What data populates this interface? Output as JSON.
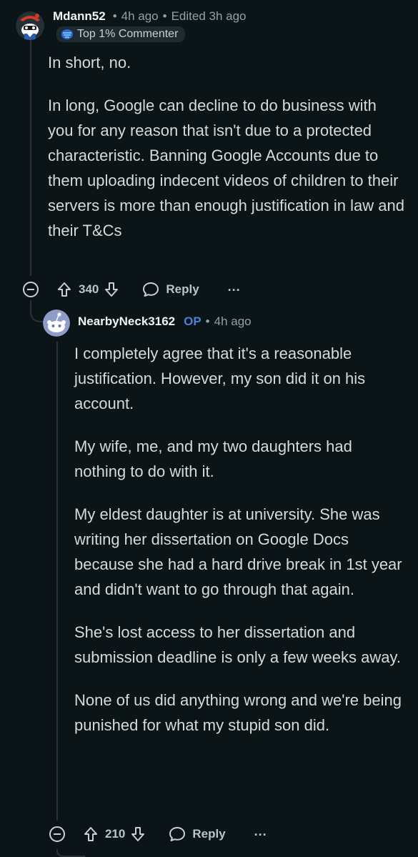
{
  "comment": {
    "username": "Mdann52",
    "time": "4h ago",
    "edited": "Edited 3h ago",
    "flair": "Top 1% Commenter",
    "paragraphs": [
      "In short, no.",
      "In long, Google can decline to do business with you for any reason that isn't due to a protected characteristic. Banning Google Accounts due to them uploading indecent videos of children to their servers is more than enough justification in law and their T&Cs"
    ],
    "score": "340",
    "reply_label": "Reply",
    "more_label": "..."
  },
  "reply": {
    "username": "NearbyNeck3162",
    "op_badge": "OP",
    "time": "4h ago",
    "paragraphs": [
      "I completely agree that it's a reasonable justification. However, my son did it on his account.",
      "My wife, me, and my two daughters had nothing to do with it.",
      "My eldest daughter is at university. She was writing her dissertation on Google Docs because she had a hard drive break in 1st year and didn't want to go through that again.",
      "She's lost access to her dissertation and submission deadline is only a few weeks away.",
      "None of us did anything wrong and we're being punished for what my stupid son did."
    ],
    "score": "210",
    "reply_label": "Reply",
    "more_label": "..."
  },
  "colors": {
    "background": "#0b1416",
    "text": "#d7dadc",
    "meta": "#8ba2ad",
    "op": "#4f7ed6"
  }
}
